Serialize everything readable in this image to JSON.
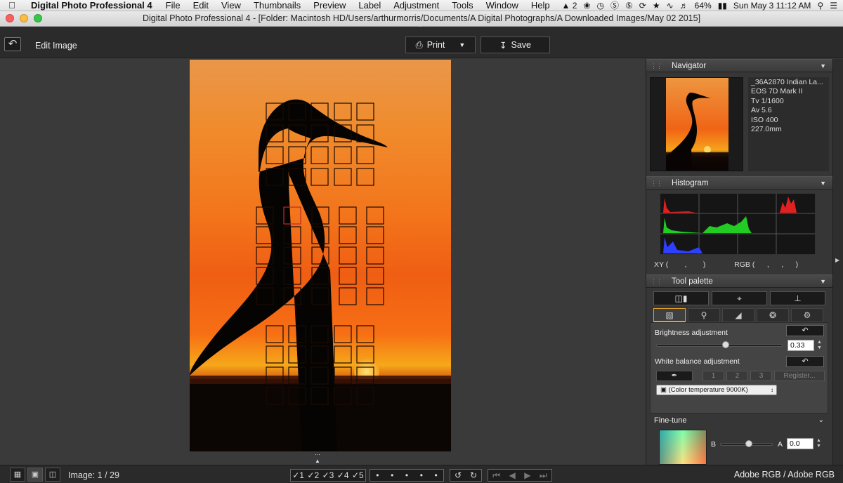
{
  "menubar": {
    "app": "Digital Photo Professional 4",
    "items": [
      "File",
      "Edit",
      "View",
      "Thumbnails",
      "Preview",
      "Label",
      "Adjustment",
      "Tools",
      "Window",
      "Help"
    ],
    "status": {
      "adobe": "2",
      "battery": "64%",
      "clock": "Sun May 3  11:12 AM"
    }
  },
  "window": {
    "title": "Digital Photo Professional 4 - [Folder: Macintosh HD/Users/arthurmorris/Documents/A Digital Photographs/A Downloaded Images/May 02 2015]"
  },
  "toolbar": {
    "edit_title": "Edit Image",
    "print_label": "Print",
    "save_label": "Save"
  },
  "statusbar": {
    "image_count": "Image: 1 / 29",
    "ratings": [
      "1",
      "2",
      "3",
      "4",
      "5"
    ],
    "color_space": "Adobe RGB / Adobe RGB"
  },
  "navigator": {
    "title": "Navigator",
    "info": [
      "_36A2870 Indian La...",
      "EOS 7D Mark II",
      "Tv 1/1600",
      "Av 5.6",
      "ISO 400",
      "227.0mm"
    ]
  },
  "histogram": {
    "title": "Histogram",
    "xy_label": "XY (        ,        )",
    "rgb_label": "RGB (      ,      ,      )"
  },
  "tool_palette": {
    "title": "Tool palette",
    "brightness_label": "Brightness adjustment",
    "brightness_value": "0.33",
    "brightness_level": 0.55,
    "wb_label": "White balance adjustment",
    "wb_buttons": [
      "1",
      "2",
      "3"
    ],
    "register_label": "Register...",
    "wb_selected": "(Color temperature 9000K)",
    "finetune_label": "Fine-tune",
    "finetune_b": "B",
    "finetune_a": "A",
    "finetune_value": "0.0",
    "finetune_level": 0.55
  },
  "colors": {
    "accent": "#e8a227",
    "af_active": "#c0282a"
  }
}
